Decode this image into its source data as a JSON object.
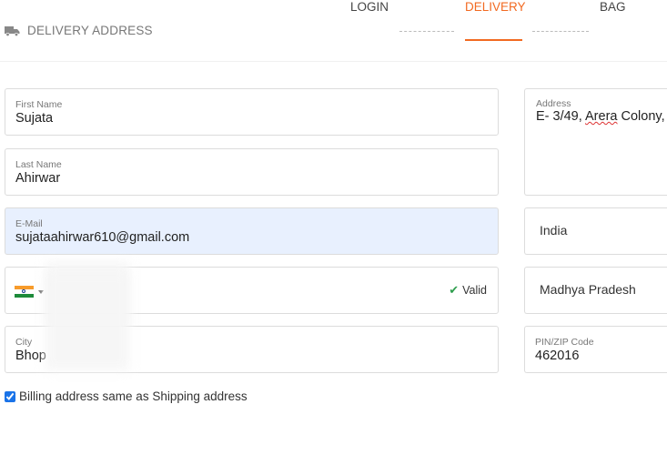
{
  "header": {
    "title": "DELIVERY ADDRESS",
    "steps": [
      {
        "label": "LOGIN",
        "active": false
      },
      {
        "label": "DELIVERY",
        "active": true
      },
      {
        "label": "BAG",
        "active": false
      }
    ],
    "accent_color": "#f26a21"
  },
  "form": {
    "first_name": {
      "label": "First Name",
      "value": "Sujata"
    },
    "last_name": {
      "label": "Last Name",
      "value": "Ahirwar"
    },
    "email": {
      "label": "E-Mail",
      "value": "sujataahirwar610@gmail.com"
    },
    "phone": {
      "country_flag": "india-flag-icon",
      "status": "Valid"
    },
    "city": {
      "label": "City",
      "value": "Bhop"
    },
    "address": {
      "label": "Address",
      "value_prefix": "E- 3/49, ",
      "value_wavy": "Arera",
      "value_suffix": " Colony,"
    },
    "country": {
      "value": "India"
    },
    "state": {
      "value": "Madhya Pradesh"
    },
    "pin": {
      "label": "PIN/ZIP Code",
      "value": "462016"
    }
  },
  "billing": {
    "label": "Billing address same as Shipping address",
    "checked": true
  }
}
